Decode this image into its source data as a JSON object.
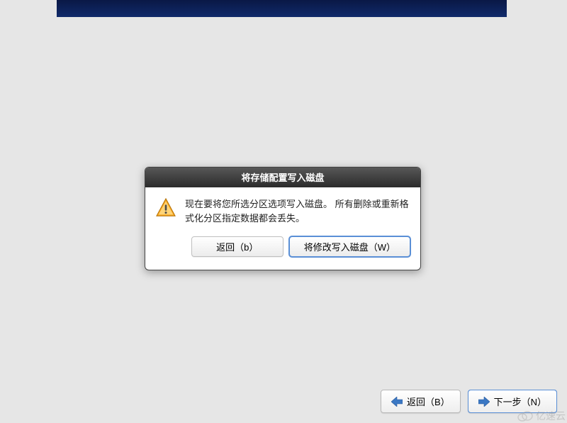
{
  "modal": {
    "title": "将存储配置写入磁盘",
    "message": "现在要将您所选分区选项写入磁盘。  所有删除或重新格式化分区指定数据都会丢失。",
    "back_label": "返回（b）",
    "write_label": "将修改写入磁盘（W）"
  },
  "footer": {
    "back_label": "返回（B）",
    "next_label": "下一步（N）"
  },
  "watermark": {
    "text": "亿速云"
  },
  "colors": {
    "header_dark": "#0a1845",
    "header_light": "#102a6b",
    "focus_ring": "#5a8fd6"
  }
}
